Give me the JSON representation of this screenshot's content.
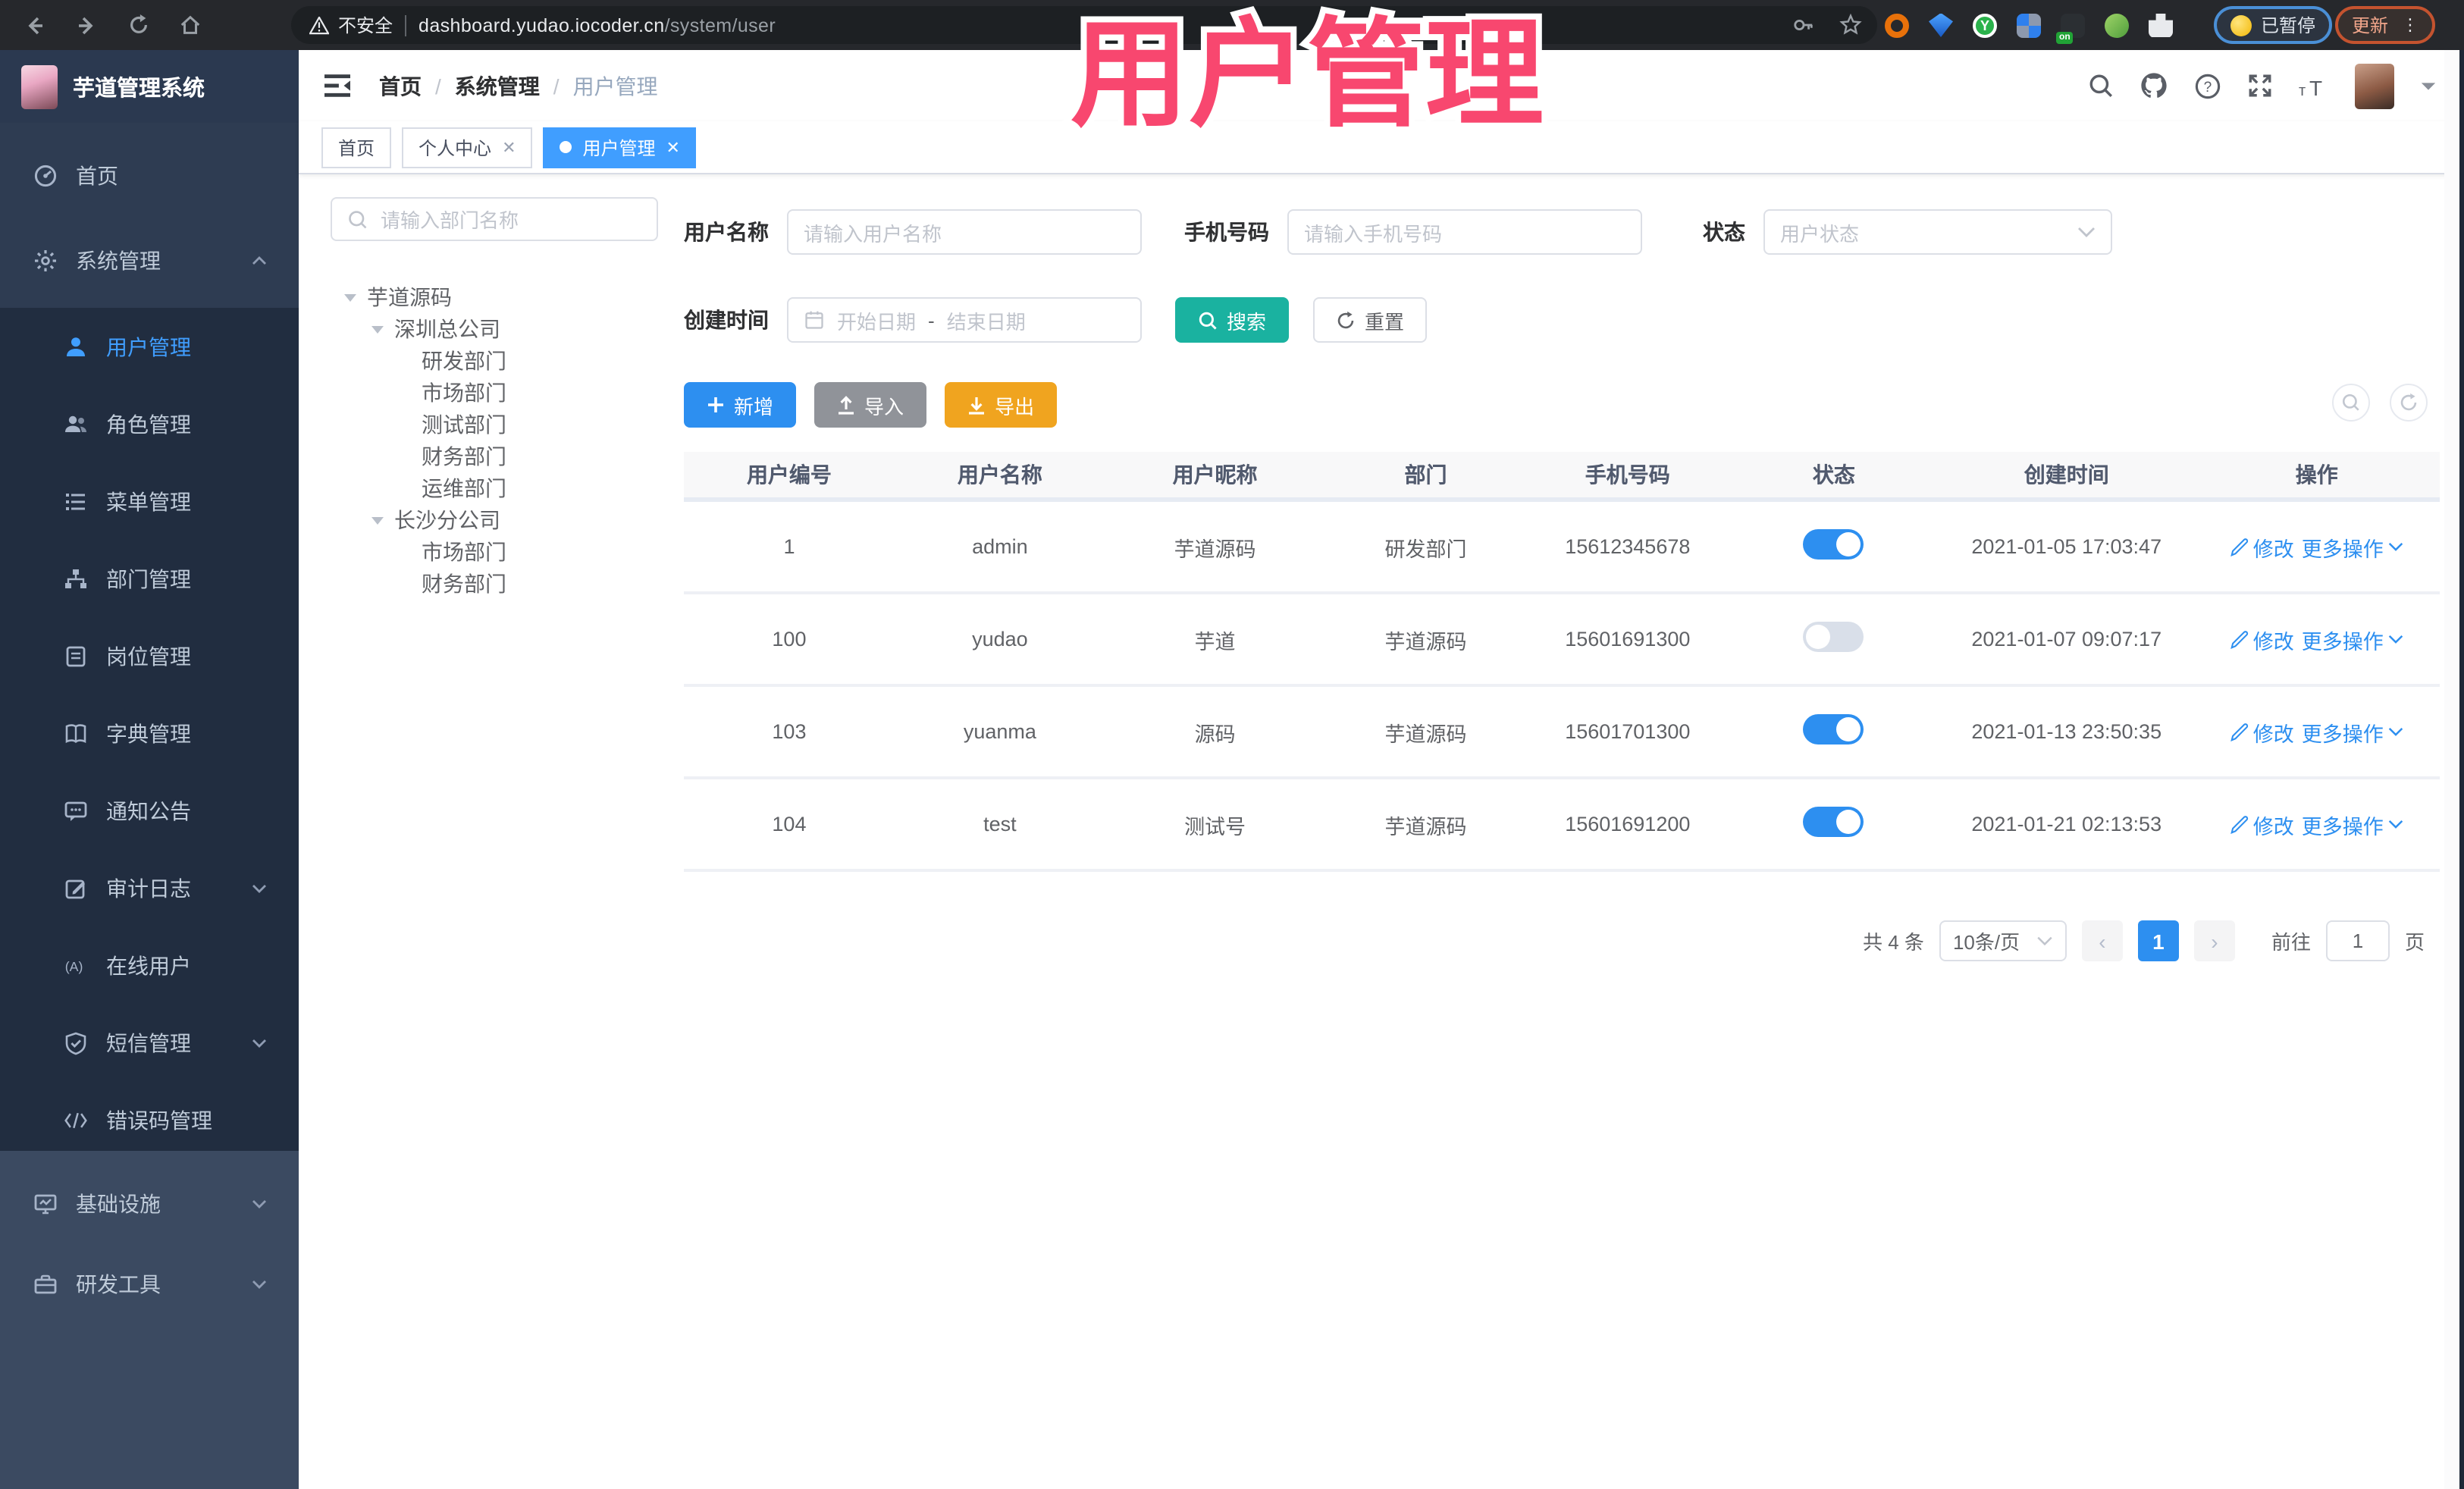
{
  "browser": {
    "not_secure": "不安全",
    "url_host": "dashboard.yudao.iocoder.cn",
    "url_path": "/system/user",
    "paused_label": "已暂停",
    "update_label": "更新"
  },
  "watermark": {
    "text": "用户管理",
    "color": "#f8476f"
  },
  "app": {
    "title": "芋道管理系统"
  },
  "breadcrumb": {
    "items": [
      "首页",
      "系统管理",
      "用户管理"
    ],
    "separator": "/"
  },
  "tabs": [
    {
      "label": "首页",
      "closable": false,
      "active": false
    },
    {
      "label": "个人中心",
      "closable": true,
      "active": false
    },
    {
      "label": "用户管理",
      "closable": true,
      "active": true
    }
  ],
  "sidebar": {
    "home": "首页",
    "system": "系统管理",
    "system_children": [
      {
        "label": "用户管理",
        "active": true
      },
      {
        "label": "角色管理"
      },
      {
        "label": "菜单管理"
      },
      {
        "label": "部门管理"
      },
      {
        "label": "岗位管理"
      },
      {
        "label": "字典管理"
      },
      {
        "label": "通知公告"
      },
      {
        "label": "审计日志",
        "expandable": true
      },
      {
        "label": "在线用户"
      },
      {
        "label": "短信管理",
        "expandable": true
      },
      {
        "label": "错误码管理"
      }
    ],
    "infra": "基础设施",
    "devtools": "研发工具"
  },
  "dept_tree": {
    "search_placeholder": "请输入部门名称",
    "nodes": [
      {
        "label": "芋道源码",
        "level": 0,
        "parent": true
      },
      {
        "label": "深圳总公司",
        "level": 1,
        "parent": true
      },
      {
        "label": "研发部门",
        "level": 2
      },
      {
        "label": "市场部门",
        "level": 2
      },
      {
        "label": "测试部门",
        "level": 2
      },
      {
        "label": "财务部门",
        "level": 2
      },
      {
        "label": "运维部门",
        "level": 2
      },
      {
        "label": "长沙分公司",
        "level": 1,
        "parent": true
      },
      {
        "label": "市场部门",
        "level": 2
      },
      {
        "label": "财务部门",
        "level": 2
      }
    ]
  },
  "filters": {
    "username_label": "用户名称",
    "username_placeholder": "请输入用户名称",
    "mobile_label": "手机号码",
    "mobile_placeholder": "请输入手机号码",
    "status_label": "状态",
    "status_placeholder": "用户状态",
    "create_time_label": "创建时间",
    "date_start_placeholder": "开始日期",
    "date_separator": "-",
    "date_end_placeholder": "结束日期",
    "search_label": "搜索",
    "reset_label": "重置"
  },
  "toolbar": {
    "add_label": "新增",
    "import_label": "导入",
    "export_label": "导出"
  },
  "table": {
    "columns": [
      "用户编号",
      "用户名称",
      "用户昵称",
      "部门",
      "手机号码",
      "状态",
      "创建时间",
      "操作"
    ],
    "edit_label": "修改",
    "more_label": "更多操作",
    "rows": [
      {
        "id": "1",
        "username": "admin",
        "nickname": "芋道源码",
        "dept": "研发部门",
        "mobile": "15612345678",
        "status": "on",
        "created": "2021-01-05 17:03:47"
      },
      {
        "id": "100",
        "username": "yudao",
        "nickname": "芋道",
        "dept": "芋道源码",
        "mobile": "15601691300",
        "status": "off",
        "created": "2021-01-07 09:07:17"
      },
      {
        "id": "103",
        "username": "yuanma",
        "nickname": "源码",
        "dept": "芋道源码",
        "mobile": "15601701300",
        "status": "on",
        "created": "2021-01-13 23:50:35"
      },
      {
        "id": "104",
        "username": "test",
        "nickname": "测试号",
        "dept": "芋道源码",
        "mobile": "15601691200",
        "status": "on",
        "created": "2021-01-21 02:13:53"
      }
    ]
  },
  "pagination": {
    "total": "共 4 条",
    "page_size": "10条/页",
    "current_page": "1",
    "goto_label": "前往",
    "goto_value": "1",
    "page_unit": "页"
  },
  "colors": {
    "primary": "#409eff",
    "link": "#2d8ff0",
    "search_button": "#1ab2a0",
    "add_button": "#2d8ff0",
    "import_button": "#909399",
    "export_button": "#f0a41f",
    "watermark": "#f8476f",
    "sidebar_bg": "#2e3c52",
    "submenu_bg": "#212d40"
  }
}
